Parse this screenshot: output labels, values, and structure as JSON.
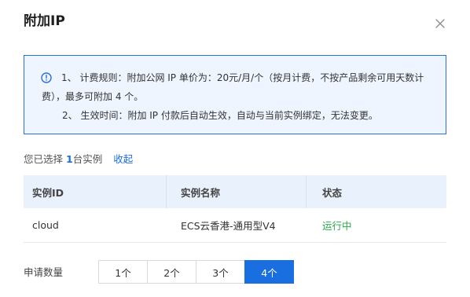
{
  "dialog": {
    "title": "附加IP",
    "close_icon": "close-icon"
  },
  "notice": {
    "icon": "info-circle-icon",
    "accent": "#2b6fd6",
    "line1": "1、 计费规则：附加公网 IP 单价为：20元/月/个（按月计费，不按产品剩余可用天数计",
    "line2": "费），最多可附加 4 个。",
    "line3": "2、 生效时间：附加 IP 付款后自动生效，自动与当前实例绑定，无法变更。"
  },
  "selection": {
    "prefix": "您已选择",
    "count": "1",
    "suffix": "台实例",
    "collapse_label": "收起"
  },
  "table": {
    "columns": [
      "实例ID",
      "实例名称",
      "状态"
    ],
    "rows": [
      {
        "id": "cloud",
        "name": "ECS云香港-通用型V4",
        "status": "运行中",
        "status_color": "#27a847"
      }
    ]
  },
  "quantity": {
    "label": "申请数量",
    "options": [
      "1个",
      "2个",
      "3个",
      "4个"
    ],
    "selected": "4个",
    "accent": "#1a6fe0"
  }
}
